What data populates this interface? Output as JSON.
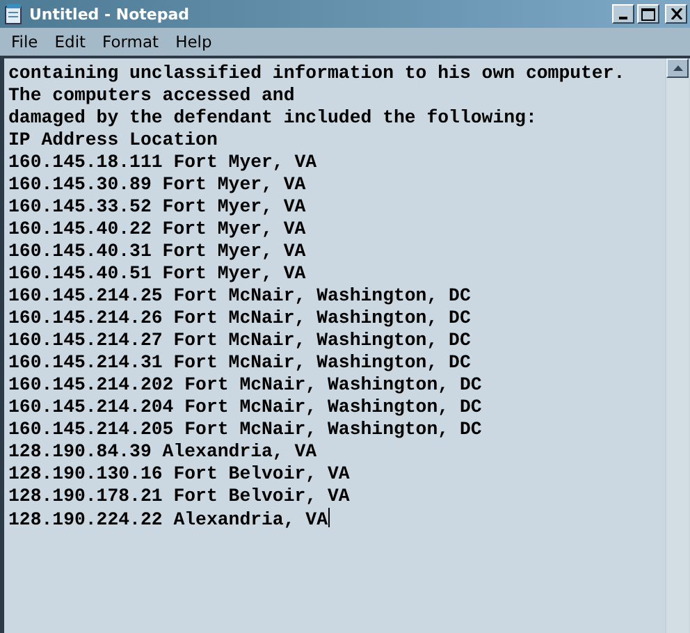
{
  "window": {
    "title": "Untitled - Notepad"
  },
  "menu": [
    "File",
    "Edit",
    "Format",
    "Help"
  ],
  "document": {
    "lines": [
      "containing unclassified information to his own computer.",
      "The computers accessed and",
      "damaged by the defendant included the following:",
      "IP Address Location",
      "160.145.18.111 Fort Myer, VA",
      "160.145.30.89 Fort Myer, VA",
      "160.145.33.52 Fort Myer, VA",
      "160.145.40.22 Fort Myer, VA",
      "160.145.40.31 Fort Myer, VA",
      "160.145.40.51 Fort Myer, VA",
      "160.145.214.25 Fort McNair, Washington, DC",
      "160.145.214.26 Fort McNair, Washington, DC",
      "160.145.214.27 Fort McNair, Washington, DC",
      "160.145.214.31 Fort McNair, Washington, DC",
      "160.145.214.202 Fort McNair, Washington, DC",
      "160.145.214.204 Fort McNair, Washington, DC",
      "160.145.214.205 Fort McNair, Washington, DC",
      "128.190.84.39 Alexandria, VA",
      "128.190.130.16 Fort Belvoir, VA",
      "128.190.178.21 Fort Belvoir, VA",
      "128.190.224.22 Alexandria, VA"
    ]
  }
}
